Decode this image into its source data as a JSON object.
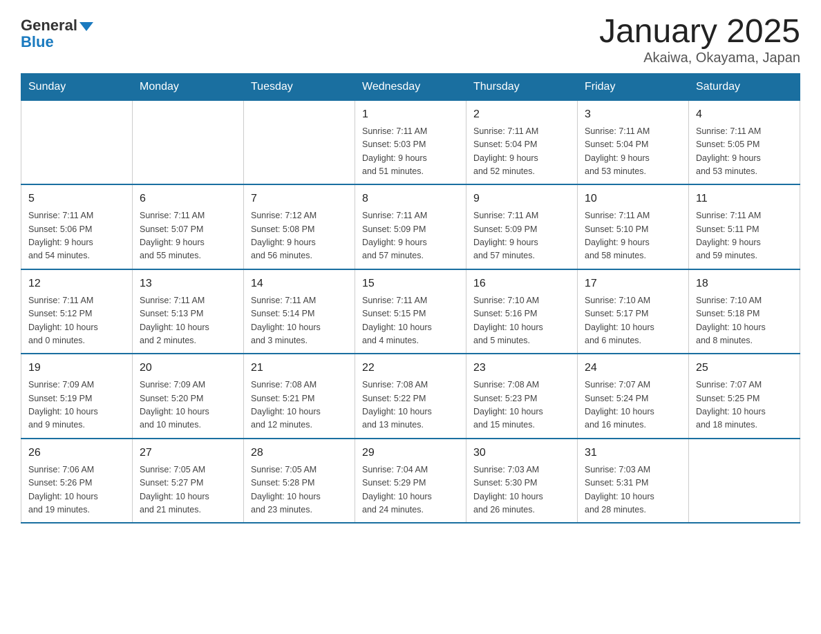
{
  "header": {
    "logo_general": "General",
    "logo_blue": "Blue",
    "title": "January 2025",
    "subtitle": "Akaiwa, Okayama, Japan"
  },
  "weekdays": [
    "Sunday",
    "Monday",
    "Tuesday",
    "Wednesday",
    "Thursday",
    "Friday",
    "Saturday"
  ],
  "weeks": [
    [
      {
        "day": "",
        "info": ""
      },
      {
        "day": "",
        "info": ""
      },
      {
        "day": "",
        "info": ""
      },
      {
        "day": "1",
        "info": "Sunrise: 7:11 AM\nSunset: 5:03 PM\nDaylight: 9 hours\nand 51 minutes."
      },
      {
        "day": "2",
        "info": "Sunrise: 7:11 AM\nSunset: 5:04 PM\nDaylight: 9 hours\nand 52 minutes."
      },
      {
        "day": "3",
        "info": "Sunrise: 7:11 AM\nSunset: 5:04 PM\nDaylight: 9 hours\nand 53 minutes."
      },
      {
        "day": "4",
        "info": "Sunrise: 7:11 AM\nSunset: 5:05 PM\nDaylight: 9 hours\nand 53 minutes."
      }
    ],
    [
      {
        "day": "5",
        "info": "Sunrise: 7:11 AM\nSunset: 5:06 PM\nDaylight: 9 hours\nand 54 minutes."
      },
      {
        "day": "6",
        "info": "Sunrise: 7:11 AM\nSunset: 5:07 PM\nDaylight: 9 hours\nand 55 minutes."
      },
      {
        "day": "7",
        "info": "Sunrise: 7:12 AM\nSunset: 5:08 PM\nDaylight: 9 hours\nand 56 minutes."
      },
      {
        "day": "8",
        "info": "Sunrise: 7:11 AM\nSunset: 5:09 PM\nDaylight: 9 hours\nand 57 minutes."
      },
      {
        "day": "9",
        "info": "Sunrise: 7:11 AM\nSunset: 5:09 PM\nDaylight: 9 hours\nand 57 minutes."
      },
      {
        "day": "10",
        "info": "Sunrise: 7:11 AM\nSunset: 5:10 PM\nDaylight: 9 hours\nand 58 minutes."
      },
      {
        "day": "11",
        "info": "Sunrise: 7:11 AM\nSunset: 5:11 PM\nDaylight: 9 hours\nand 59 minutes."
      }
    ],
    [
      {
        "day": "12",
        "info": "Sunrise: 7:11 AM\nSunset: 5:12 PM\nDaylight: 10 hours\nand 0 minutes."
      },
      {
        "day": "13",
        "info": "Sunrise: 7:11 AM\nSunset: 5:13 PM\nDaylight: 10 hours\nand 2 minutes."
      },
      {
        "day": "14",
        "info": "Sunrise: 7:11 AM\nSunset: 5:14 PM\nDaylight: 10 hours\nand 3 minutes."
      },
      {
        "day": "15",
        "info": "Sunrise: 7:11 AM\nSunset: 5:15 PM\nDaylight: 10 hours\nand 4 minutes."
      },
      {
        "day": "16",
        "info": "Sunrise: 7:10 AM\nSunset: 5:16 PM\nDaylight: 10 hours\nand 5 minutes."
      },
      {
        "day": "17",
        "info": "Sunrise: 7:10 AM\nSunset: 5:17 PM\nDaylight: 10 hours\nand 6 minutes."
      },
      {
        "day": "18",
        "info": "Sunrise: 7:10 AM\nSunset: 5:18 PM\nDaylight: 10 hours\nand 8 minutes."
      }
    ],
    [
      {
        "day": "19",
        "info": "Sunrise: 7:09 AM\nSunset: 5:19 PM\nDaylight: 10 hours\nand 9 minutes."
      },
      {
        "day": "20",
        "info": "Sunrise: 7:09 AM\nSunset: 5:20 PM\nDaylight: 10 hours\nand 10 minutes."
      },
      {
        "day": "21",
        "info": "Sunrise: 7:08 AM\nSunset: 5:21 PM\nDaylight: 10 hours\nand 12 minutes."
      },
      {
        "day": "22",
        "info": "Sunrise: 7:08 AM\nSunset: 5:22 PM\nDaylight: 10 hours\nand 13 minutes."
      },
      {
        "day": "23",
        "info": "Sunrise: 7:08 AM\nSunset: 5:23 PM\nDaylight: 10 hours\nand 15 minutes."
      },
      {
        "day": "24",
        "info": "Sunrise: 7:07 AM\nSunset: 5:24 PM\nDaylight: 10 hours\nand 16 minutes."
      },
      {
        "day": "25",
        "info": "Sunrise: 7:07 AM\nSunset: 5:25 PM\nDaylight: 10 hours\nand 18 minutes."
      }
    ],
    [
      {
        "day": "26",
        "info": "Sunrise: 7:06 AM\nSunset: 5:26 PM\nDaylight: 10 hours\nand 19 minutes."
      },
      {
        "day": "27",
        "info": "Sunrise: 7:05 AM\nSunset: 5:27 PM\nDaylight: 10 hours\nand 21 minutes."
      },
      {
        "day": "28",
        "info": "Sunrise: 7:05 AM\nSunset: 5:28 PM\nDaylight: 10 hours\nand 23 minutes."
      },
      {
        "day": "29",
        "info": "Sunrise: 7:04 AM\nSunset: 5:29 PM\nDaylight: 10 hours\nand 24 minutes."
      },
      {
        "day": "30",
        "info": "Sunrise: 7:03 AM\nSunset: 5:30 PM\nDaylight: 10 hours\nand 26 minutes."
      },
      {
        "day": "31",
        "info": "Sunrise: 7:03 AM\nSunset: 5:31 PM\nDaylight: 10 hours\nand 28 minutes."
      },
      {
        "day": "",
        "info": ""
      }
    ]
  ]
}
